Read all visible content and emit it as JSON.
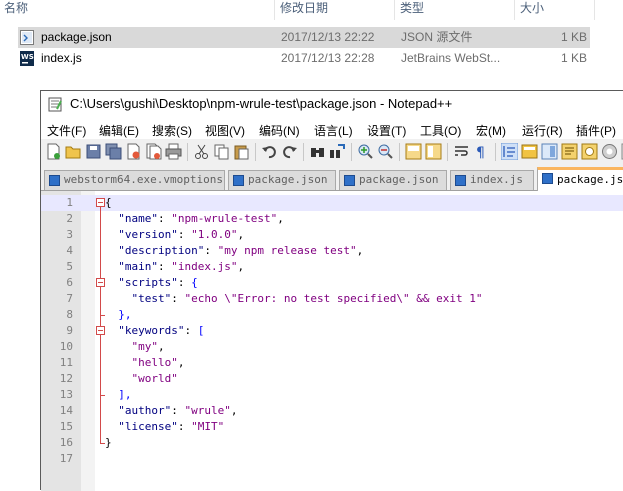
{
  "explorer": {
    "columns": {
      "name": "名称",
      "date": "修改日期",
      "type": "类型",
      "size": "大小"
    },
    "files": [
      {
        "name": "package.json",
        "date": "2017/12/13 22:22",
        "type": "JSON 源文件",
        "size": "1 KB",
        "icon": "json-file-icon",
        "selected": true
      },
      {
        "name": "index.js",
        "date": "2017/12/13 22:28",
        "type": "JetBrains WebSt...",
        "size": "1 KB",
        "icon": "webstorm-file-icon",
        "selected": false
      }
    ]
  },
  "notepad": {
    "title": "C:\\Users\\gushi\\Desktop\\npm-wrule-test\\package.json - Notepad++",
    "menu": [
      "文件(F)",
      "编辑(E)",
      "搜索(S)",
      "视图(V)",
      "编码(N)",
      "语言(L)",
      "设置(T)",
      "工具(O)",
      "宏(M)",
      "运行(R)",
      "插件(P)"
    ],
    "tabs": [
      {
        "label": "webstorm64.exe.vmoptions",
        "active": false
      },
      {
        "label": "package.json",
        "active": false
      },
      {
        "label": "package.json",
        "active": false
      },
      {
        "label": "index.js",
        "active": false
      },
      {
        "label": "package.json",
        "active": true
      }
    ],
    "line_numbers": [
      "1",
      "2",
      "3",
      "4",
      "5",
      "6",
      "7",
      "8",
      "9",
      "10",
      "11",
      "12",
      "13",
      "14",
      "15",
      "16",
      "17"
    ],
    "code": {
      "l1": "{",
      "name_key": "\"name\"",
      "name_val": "\"npm-wrule-test\"",
      "version_key": "\"version\"",
      "version_val": "\"1.0.0\"",
      "description_key": "\"description\"",
      "description_val": "\"my npm release test\"",
      "main_key": "\"main\"",
      "main_val": "\"index.js\"",
      "scripts_key": "\"scripts\"",
      "test_key": "\"test\"",
      "test_val": "\"echo \\\"Error: no test specified\\\" && exit 1\"",
      "scripts_close": "},",
      "keywords_key": "\"keywords\"",
      "kw1": "\"my\"",
      "kw2": "\"hello\"",
      "kw3": "\"world\"",
      "keywords_close": "],",
      "author_key": "\"author\"",
      "author_val": "\"wrule\"",
      "license_key": "\"license\"",
      "license_val": "\"MIT\"",
      "l16": "}"
    }
  }
}
